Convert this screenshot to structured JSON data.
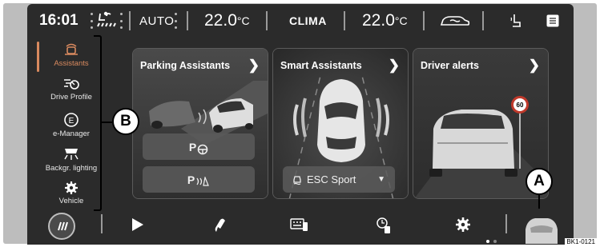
{
  "topbar": {
    "time": "16:01",
    "fan_icon": "fan-airflow-icon",
    "auto_label": "AUTO",
    "temp_left": "22.0",
    "temp_right": "22.0",
    "temp_unit": "°C",
    "clima_label": "CLIMA",
    "icons": [
      "car-airflow-icon",
      "seat-heat-icon",
      "menu-icon"
    ]
  },
  "sidebar": {
    "items": [
      {
        "label": "Assistants",
        "icon": "assistants-icon",
        "active": true
      },
      {
        "label": "Drive Profile",
        "icon": "drive-profile-icon"
      },
      {
        "label": "e-Manager",
        "icon": "e-manager-icon"
      },
      {
        "label": "Backgr. lighting",
        "icon": "ambient-light-icon"
      },
      {
        "label": "Vehicle",
        "icon": "vehicle-gear-icon"
      }
    ]
  },
  "cards": [
    {
      "title": "Parking Assistants",
      "buttons": [
        "P",
        "P"
      ]
    },
    {
      "title": "Smart Assistants",
      "button": "ESC Sport"
    },
    {
      "title": "Driver alerts",
      "speed_sign": "60"
    }
  ],
  "dock": {
    "icons": [
      "home-icon",
      "play-icon",
      "phone-icon",
      "keyboard-phone-icon",
      "fuel-icon",
      "settings-icon",
      "car-icon"
    ],
    "page_dots": 2
  },
  "callouts": {
    "a": "A",
    "b": "B"
  },
  "image_code": "BK1-0121",
  "colors": {
    "accent": "#d98a5f",
    "screen_bg": "#2b2b2b"
  }
}
